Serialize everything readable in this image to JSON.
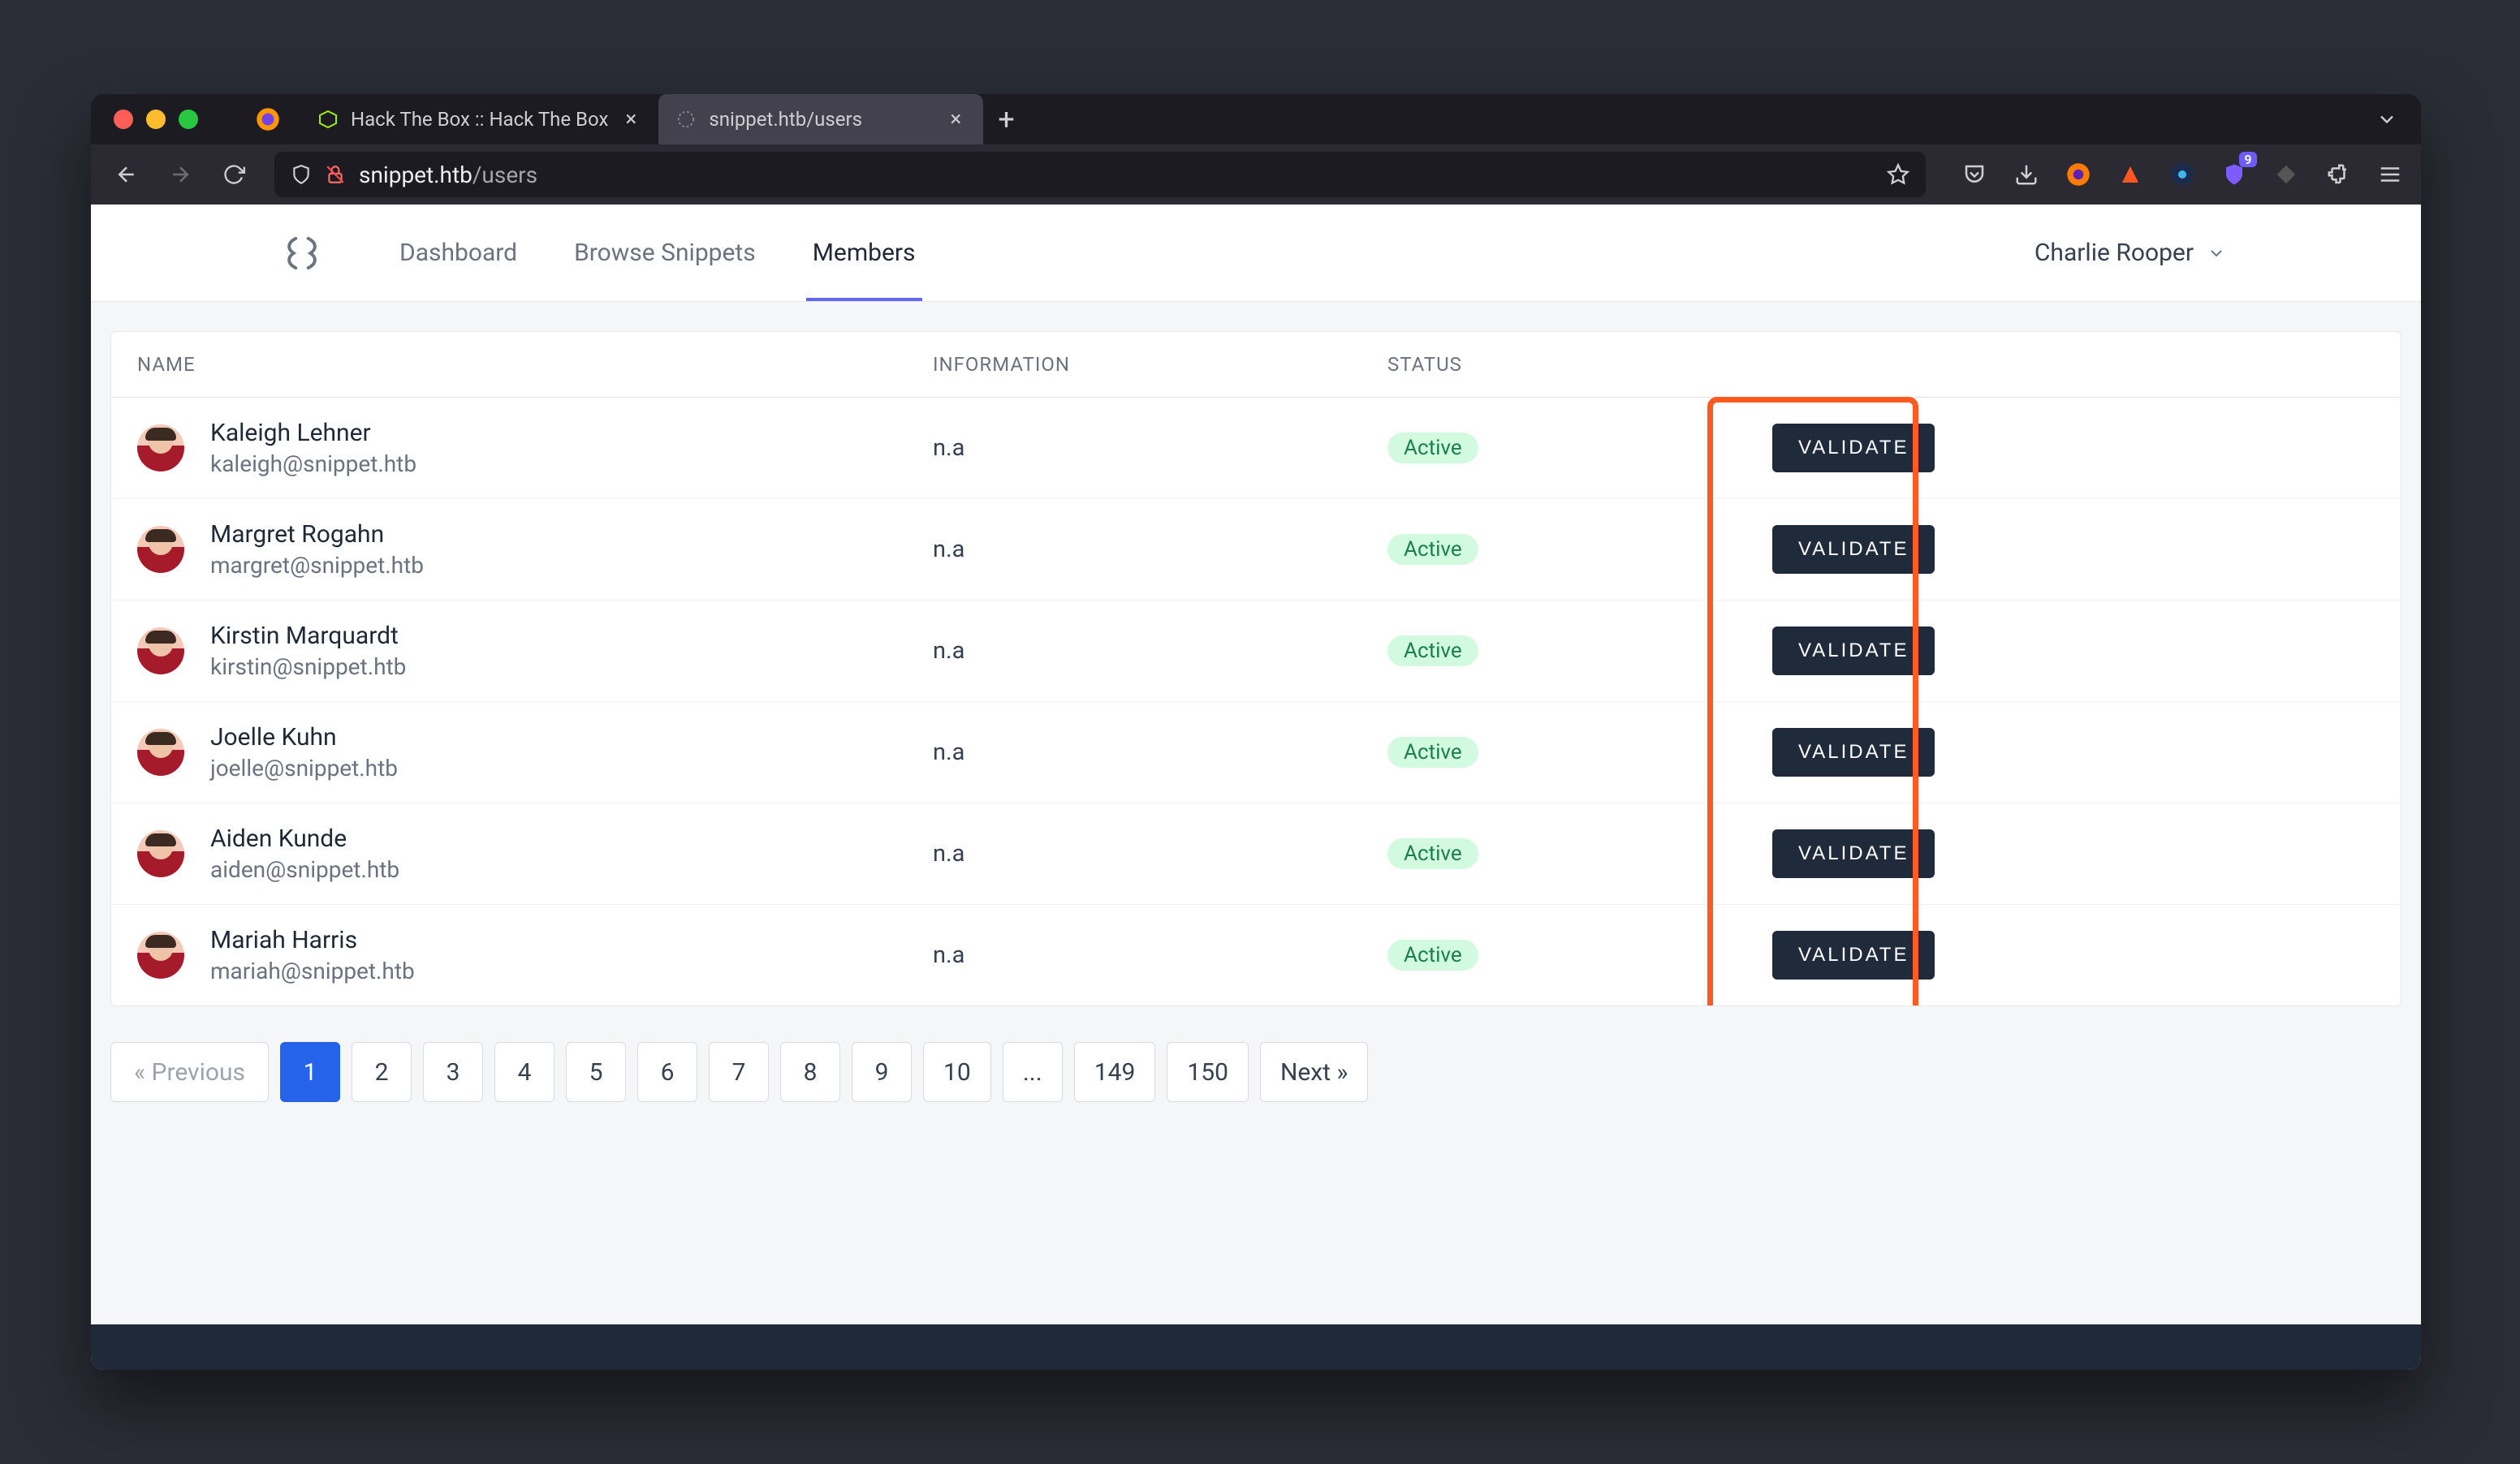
{
  "browser": {
    "tabs": [
      {
        "title": "Hack The Box :: Hack The Box",
        "active": false
      },
      {
        "title": "snippet.htb/users",
        "active": true
      }
    ],
    "address": {
      "host": "snippet.htb",
      "path": "/users"
    },
    "notification_count": "9"
  },
  "app": {
    "nav": {
      "dashboard": "Dashboard",
      "browse": "Browse Snippets",
      "members": "Members"
    },
    "user_name": "Charlie Rooper"
  },
  "table": {
    "headers": {
      "name": "Name",
      "information": "Information",
      "status": "Status"
    },
    "info_na": "n.a",
    "status_active": "Active",
    "validate_label": "VALIDATE",
    "rows": [
      {
        "name": "Kaleigh Lehner",
        "email": "kaleigh@snippet.htb"
      },
      {
        "name": "Margret Rogahn",
        "email": "margret@snippet.htb"
      },
      {
        "name": "Kirstin Marquardt",
        "email": "kirstin@snippet.htb"
      },
      {
        "name": "Joelle Kuhn",
        "email": "joelle@snippet.htb"
      },
      {
        "name": "Aiden Kunde",
        "email": "aiden@snippet.htb"
      },
      {
        "name": "Mariah Harris",
        "email": "mariah@snippet.htb"
      }
    ]
  },
  "pagination": {
    "prev": "« Previous",
    "next": "Next »",
    "pages": [
      "1",
      "2",
      "3",
      "4",
      "5",
      "6",
      "7",
      "8",
      "9",
      "10",
      "...",
      "149",
      "150"
    ],
    "active_index": 0
  }
}
